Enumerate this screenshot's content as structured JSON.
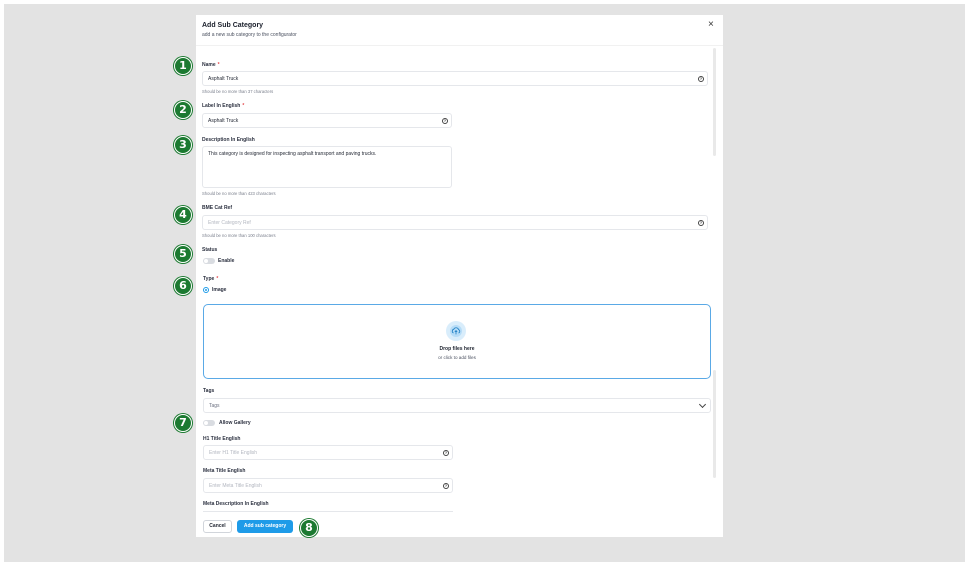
{
  "dialog": {
    "title": "Add Sub Category",
    "subtitle": "add a new sub category to the configurator",
    "close_icon": "×"
  },
  "fields": {
    "name": {
      "label": "Name",
      "required": "*",
      "value": "Asphalt Truck",
      "hint": "Should be no more than 37 characters"
    },
    "label_en": {
      "label": "Label In English",
      "required": "*",
      "value": "Asphalt Truck"
    },
    "description_en": {
      "label": "Description In English",
      "value": "This category is designed for inspecting asphalt transport and paving trucks.",
      "hint": "Should be no more than 423 characters"
    },
    "bme_cat_ref": {
      "label": "BME Cat Ref",
      "placeholder": "Enter Category Ref",
      "hint": "Should be no more than 100 characters"
    },
    "status": {
      "label": "Status",
      "toggle_label": "Enable",
      "enabled": false
    },
    "type": {
      "label": "Type",
      "required": "*",
      "option": "Image",
      "selected": true
    },
    "dropzone": {
      "title": "Drop files here",
      "subtitle": "or click to add files",
      "icon": "upload-cloud-icon"
    },
    "tags": {
      "label": "Tags",
      "placeholder": "Tags"
    },
    "allow_gallery": {
      "toggle_label": "Allow Gallery",
      "enabled": false
    },
    "h1_title_en": {
      "label": "H1 Title English",
      "placeholder": "Enter H1 Title English"
    },
    "meta_title_en": {
      "label": "Meta Title English",
      "placeholder": "Enter Meta Title English"
    },
    "meta_description_en": {
      "label": "Meta Description In English"
    }
  },
  "help_icon": "?",
  "buttons": {
    "cancel": "Cancel",
    "add": "Add sub category"
  },
  "annotations": [
    "1",
    "2",
    "3",
    "4",
    "5",
    "6",
    "7",
    "8"
  ],
  "colors": {
    "accent": "#1e9be8",
    "badge": "#1c7a31",
    "required": "#e5484d"
  }
}
